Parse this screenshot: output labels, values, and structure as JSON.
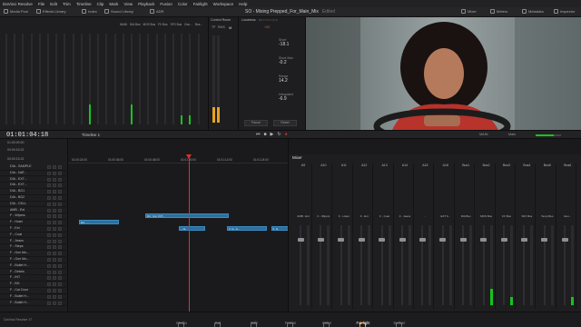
{
  "menu": [
    "DaVinci Resolve",
    "File",
    "Edit",
    "Trim",
    "Timeline",
    "Clip",
    "Mark",
    "View",
    "Playback",
    "Fusion",
    "Color",
    "Fairlight",
    "Workspace",
    "Help"
  ],
  "toolbar": {
    "media_pool": "Media Pool",
    "effects_library": "Effects Library",
    "index": "Index",
    "sound_library": "Sound Library",
    "adr": "ADR",
    "mixer": "Mixer",
    "meters": "Meters",
    "metadata": "Metadata",
    "inspector": "Inspector"
  },
  "project_title": "SO - Mixing Prepped_For_Main_Mix",
  "title_status": "Edited",
  "meters": {
    "bus_labels": [
      "MAIN",
      "DIA Bus",
      "MOS Bus",
      "FX Bus",
      "SFX Bus",
      "Gun...",
      "Bus..."
    ],
    "levels": [
      0.0,
      0.0,
      0.0,
      0.0,
      0.0,
      0.0,
      0.0,
      0.0,
      0.0,
      0.0,
      0.22,
      0.0,
      0.0,
      0.0,
      0.0,
      0.22,
      0.0,
      0.0,
      0.0,
      0.0,
      0.0,
      0.1,
      0.1,
      0.0
    ]
  },
  "control_room": {
    "title": "Control Room",
    "tp": "TP",
    "rms": "RMS",
    "m_label": "M",
    "plus": "+20",
    "level": 0.18
  },
  "loudness": {
    "title": "Loudness",
    "standard": "BS.1770-1 (LU)",
    "items": [
      {
        "label": "Short",
        "value": "-18.1"
      },
      {
        "label": "Short Max",
        "value": "-0.2"
      },
      {
        "label": "Range",
        "value": "14.2"
      },
      {
        "label": "Integrated",
        "value": "-6.9"
      }
    ],
    "pause": "Pause",
    "reset": "Reset"
  },
  "timeline": {
    "timecode": "01:01:04:18",
    "name": "Timeline 1",
    "tc_rows": [
      "01:00:00:00",
      "00:00:15:22",
      "00:00:15:22"
    ],
    "ruler": [
      "01:00:24:00",
      "01:00:36:00",
      "01:00:48:00",
      "01:01:00:00",
      "01:01:12:00",
      "01:01:24:00"
    ],
    "output": "MAIN",
    "monitor": "Main"
  },
  "tracks": [
    "DIA - SAMPLE",
    "DIA - NAT...",
    "DIA - EXT...",
    "DIA - EXT...",
    "DIA - BG1",
    "DIA - BG2",
    "DIA - CELL",
    "AMB - Ext",
    "F - Wipers",
    "F - Hotel",
    "F - Ext",
    "F - Coat",
    "F - Jeans",
    "F - Steps",
    "F - Gun Mo...",
    "F - Gun Mo...",
    "F - Bullet H...",
    "F - Debris",
    "F - INT",
    "F - BG",
    "F - Car Door",
    "F - Bullet H...",
    "F - Bullet H..."
  ],
  "clips": [
    {
      "row": 9,
      "start": 0.05,
      "len": 0.18,
      "label": "DC_..."
    },
    {
      "row": 8,
      "start": 0.35,
      "len": 0.38,
      "label": "DC_Cut_INT..."
    },
    {
      "row": 10,
      "start": 0.5,
      "len": 0.12,
      "label": "...mt"
    },
    {
      "row": 10,
      "start": 0.72,
      "len": 0.18,
      "label": "3_G...F..."
    },
    {
      "row": 10,
      "start": 0.92,
      "len": 0.08,
      "label": "3_G"
    }
  ],
  "mixer": {
    "title": "Mixer",
    "channels": [
      "A9",
      "A10",
      "A11",
      "A12",
      "A13",
      "A14",
      "A15",
      "A16",
      "Bus1",
      "Bus2",
      "Bus3",
      "Bus4",
      "Bus5",
      "Bus6"
    ],
    "strip_labels": [
      "AMB - Ext",
      "F - Wipers",
      "F - Hotel",
      "F - Ext",
      "F - Coat",
      "F - Jeans",
      "...",
      "EXT F...",
      "DIA Bus",
      "MOS Bus",
      "FX Bus",
      "SFX Bus",
      "Temp Bus",
      "Gun..."
    ],
    "levels": [
      0.0,
      0.0,
      0.0,
      0.0,
      0.0,
      0.0,
      0.0,
      0.0,
      0.0,
      0.2,
      0.1,
      0.0,
      0.0,
      0.1
    ]
  },
  "pages": [
    {
      "label": "Media",
      "icon": "media-icon"
    },
    {
      "label": "Cut",
      "icon": "cut-icon"
    },
    {
      "label": "Edit",
      "icon": "edit-icon"
    },
    {
      "label": "Fusion",
      "icon": "fusion-icon"
    },
    {
      "label": "Color",
      "icon": "color-icon"
    },
    {
      "label": "Fairlight",
      "icon": "fairlight-icon"
    },
    {
      "label": "Deliver",
      "icon": "deliver-icon"
    }
  ],
  "app_version": "DaVinci Resolve 17",
  "colors": {
    "accent": "#ff9a2e",
    "meter_green": "#18c21e",
    "clip_blue": "#2c6f9c",
    "playhead": "#e0302a"
  }
}
